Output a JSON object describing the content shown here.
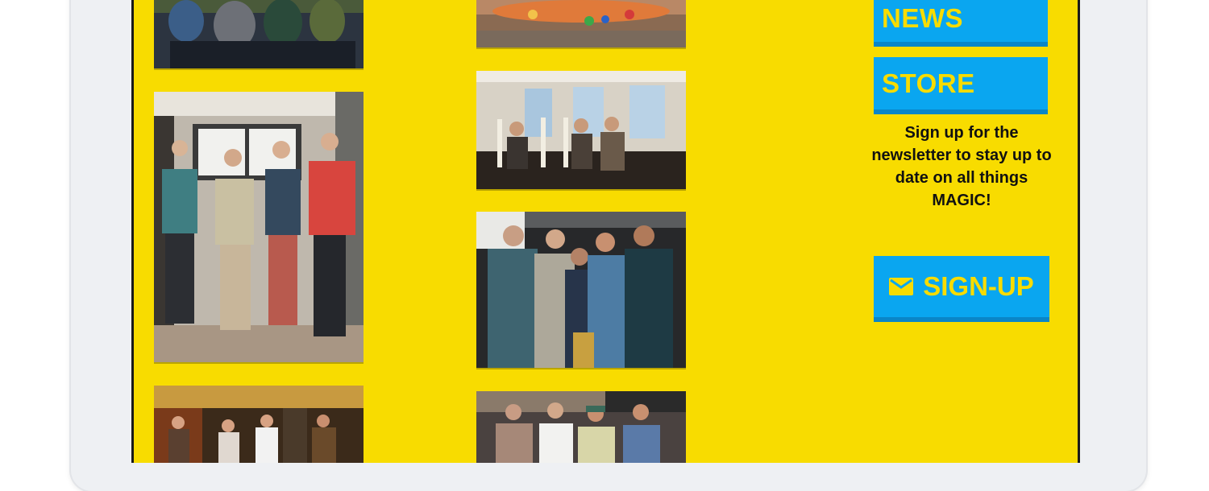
{
  "nav": {
    "news_label": "NEWS",
    "store_label": "STORE"
  },
  "newsletter": {
    "text": "Sign up for the newsletter to stay up to date on all things MAGIC!",
    "signup_label": "SIGN-UP",
    "icon": "mail-icon"
  },
  "colors": {
    "background": "#f8dc00",
    "button": "#0aa6f0",
    "button_text": "#f8dc00"
  },
  "photos": [
    "band-photo-1",
    "band-photo-2",
    "band-photo-3",
    "band-photo-4",
    "band-photo-5",
    "band-photo-6",
    "band-photo-7"
  ]
}
